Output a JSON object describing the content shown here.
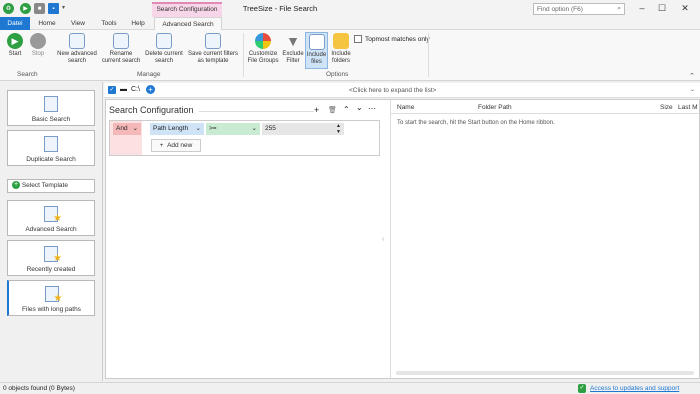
{
  "window": {
    "title": "TreeSize - File Search",
    "context_tab": "Search Configuration",
    "search_placeholder": "Find option (F6)"
  },
  "tabs": [
    "Datei",
    "Home",
    "View",
    "Tools",
    "Help",
    "Advanced Search"
  ],
  "ribbon": {
    "start": "Start",
    "stop": "Stop",
    "new_adv": "New advanced search",
    "rename": "Rename current search",
    "delete": "Delete current search",
    "save": "Save current filters as template",
    "customize": "Customize File Groups",
    "exclude": "Exclude Filter",
    "include_files": "Include files",
    "include_folders": "Include folders",
    "topmost": "Topmost matches only",
    "group_search": "Search",
    "group_manage": "Manage",
    "group_options": "Options"
  },
  "sidebar": {
    "basic": "Basic Search",
    "duplicate": "Duplicate Search",
    "select_template": "Select Template",
    "advanced": "Advanced Search",
    "recent": "Recently created",
    "long_paths": "Files with long paths"
  },
  "pathbar": {
    "drive": "C:\\",
    "hint": "<Click here to expand the list>"
  },
  "config": {
    "title": "Search Configuration",
    "op": "And",
    "field": "Path Length",
    "cmp": ">=",
    "value": "255",
    "add_new": "Add new"
  },
  "results": {
    "columns": [
      "Name",
      "Folder Path",
      "Size",
      "Last M"
    ],
    "empty_msg": "To start the search, hit the Start button on the Home ribbon."
  },
  "status": {
    "left": "0 objects found (0 Bytes)",
    "right": "Access to updates and support"
  },
  "colors": {
    "accent": "#1e78d2",
    "green": "#2ea043",
    "pink": "#f6d6e8"
  }
}
